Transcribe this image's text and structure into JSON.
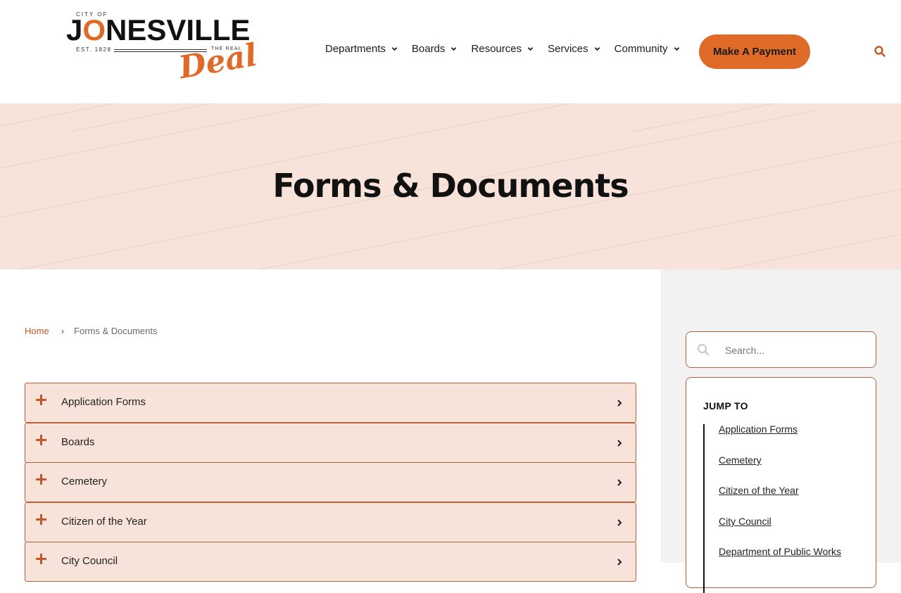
{
  "logo": {
    "city_of": "CITY OF",
    "name_j": "J",
    "name_o": "O",
    "name_rest": "NESVILLE",
    "est": "EST. 1828",
    "the_real": "THE REAL",
    "deal": "Deal"
  },
  "nav": {
    "items": [
      {
        "label": "Departments"
      },
      {
        "label": "Boards"
      },
      {
        "label": "Resources"
      },
      {
        "label": "Services"
      },
      {
        "label": "Community"
      }
    ],
    "payment_button": "Make A Payment",
    "search_icon": "search-icon"
  },
  "hero": {
    "title": "Forms & Documents"
  },
  "breadcrumb": {
    "home": "Home",
    "separator": "›",
    "current": "Forms & Documents"
  },
  "accordion": {
    "items": [
      {
        "label": "Application Forms"
      },
      {
        "label": "Boards"
      },
      {
        "label": "Cemetery"
      },
      {
        "label": "Citizen of the Year"
      },
      {
        "label": "City Council"
      }
    ]
  },
  "sidebar": {
    "search_placeholder": "Search...",
    "jump_title": "JUMP TO",
    "jump_links": [
      {
        "label": "Application Forms"
      },
      {
        "label": "Cemetery"
      },
      {
        "label": "Citizen of the Year"
      },
      {
        "label": "City Council"
      },
      {
        "label": "Department of Public Works"
      }
    ]
  },
  "colors": {
    "accent": "#e06a28",
    "hero_bg": "#f7e3d9",
    "border": "#b9603a",
    "sidebar_bg": "#f2f2f2"
  }
}
